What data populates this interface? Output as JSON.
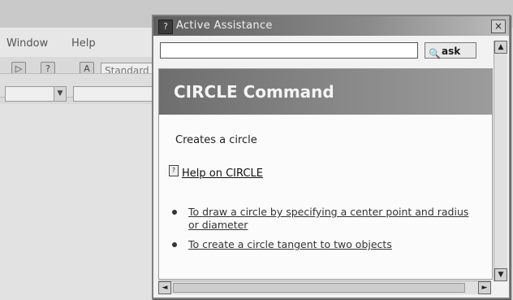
{
  "background_app": {
    "menu": [
      "Window",
      "Help"
    ],
    "style_box_text": "Standard"
  },
  "help_window": {
    "title": "Active Assistance",
    "close_label": "×",
    "title_icon": "?",
    "search": {
      "value": "",
      "placeholder": ""
    },
    "ask_label": "ask",
    "ask_icon_glyph": "🔍",
    "header_title": "CIRCLE Command",
    "description": "Creates a circle",
    "help_link": "Help on CIRCLE",
    "help_link_icon": "?",
    "bullets": [
      "To draw a circle by specifying a center point and radius or diameter",
      "To create a circle tangent to two objects"
    ],
    "scroll_up": "▲",
    "scroll_down": "▼",
    "scroll_left": "◄",
    "scroll_right": "►"
  },
  "colors": {
    "title_bar": "#6f6f6f",
    "header_band": "#7a7a7a",
    "background": "#d9d9d9"
  }
}
